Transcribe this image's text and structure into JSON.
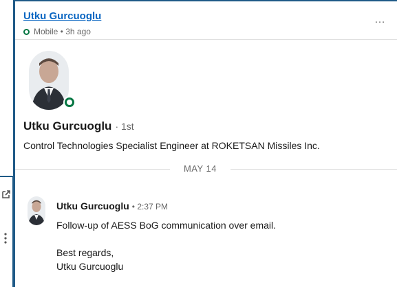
{
  "conversation": {
    "header": {
      "name": "Utku Gurcuoglu",
      "status": "Mobile • 3h ago",
      "more_label": "…"
    },
    "profile": {
      "name": "Utku Gurcuoglu",
      "degree": "· 1st",
      "headline": "Control Technologies Specialist Engineer at ROKETSAN Missiles Inc.",
      "online": true
    },
    "date_divider": "MAY 14",
    "messages": [
      {
        "sender": "Utku Gurcuoglu",
        "time": "• 2:37 PM",
        "lines": [
          "Follow-up of AESS BoG communication over email.",
          "",
          "Best regards,",
          "Utku Gurcuoglu"
        ]
      }
    ]
  },
  "side_rail": {
    "icons": [
      "external-link-icon",
      "more-vertical-icon"
    ]
  },
  "colors": {
    "link_blue": "#0a66c2",
    "online_green": "#057642",
    "frame_blue": "#1f5a87",
    "muted_text": "#666666"
  }
}
